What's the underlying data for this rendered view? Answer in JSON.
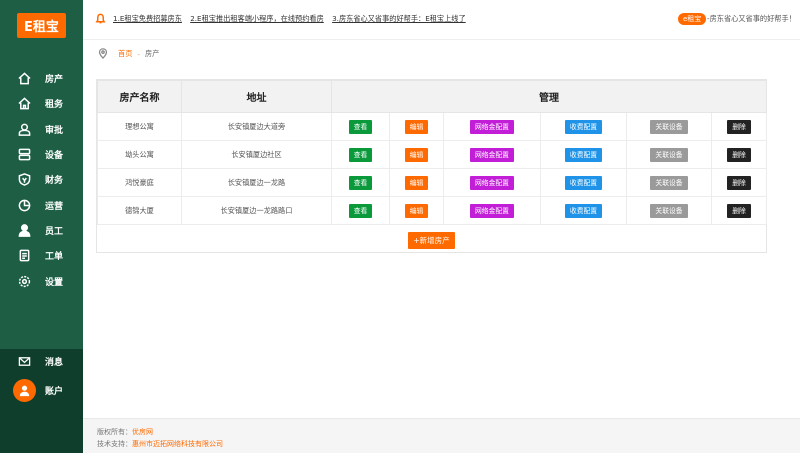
{
  "sidebar": {
    "logo": "E租宝",
    "items": [
      {
        "label": "房产",
        "icon": "home-icon"
      },
      {
        "label": "租务",
        "icon": "house-icon"
      },
      {
        "label": "审批",
        "icon": "user-check-icon"
      },
      {
        "label": "设备",
        "icon": "device-icon"
      },
      {
        "label": "财务",
        "icon": "shield-icon"
      },
      {
        "label": "运营",
        "icon": "pie-chart-icon"
      },
      {
        "label": "员工",
        "icon": "person-icon"
      },
      {
        "label": "工单",
        "icon": "document-icon"
      },
      {
        "label": "设置",
        "icon": "gear-icon"
      }
    ],
    "message_label": "消息",
    "account_label": "账户"
  },
  "topbar": {
    "notices": [
      "1.E租宝免费招募房东",
      "2.E租宝推出租客端小程序，在线预约看房",
      "3.房东省心又省事的好帮手：E租宝上线了"
    ],
    "tag": "e租宝",
    "tag_text": "-房东省心又省事的好帮手！"
  },
  "breadcrumb": {
    "home": "首页",
    "sep": "-",
    "current": "房产"
  },
  "table": {
    "headers": {
      "name": "房产名称",
      "address": "地址",
      "manage": "管理"
    },
    "actions": {
      "view": "查看",
      "edit": "编辑",
      "payment": "网络金配置",
      "fee": "收费配置",
      "device": "关联设备",
      "delete": "删除"
    },
    "rows": [
      {
        "name": "理想公寓",
        "address": "长安镇厦边大道旁"
      },
      {
        "name": "坳头公寓",
        "address": "长安镇厦边社区"
      },
      {
        "name": "鸿悦豪庭",
        "address": "长安镇厦边一龙路"
      },
      {
        "name": "德锦大厦",
        "address": "长安镇厦边一龙路路口"
      }
    ],
    "add_label": "+新增房产"
  },
  "footer": {
    "copyright_label": "版权所有：",
    "copyright_value": "优房网",
    "support_label": "技术支持：",
    "support_value": "惠州市迈拓网络科技有限公司"
  },
  "colors": {
    "sidebar": "#1d5e45",
    "accent": "#ff6a00"
  }
}
